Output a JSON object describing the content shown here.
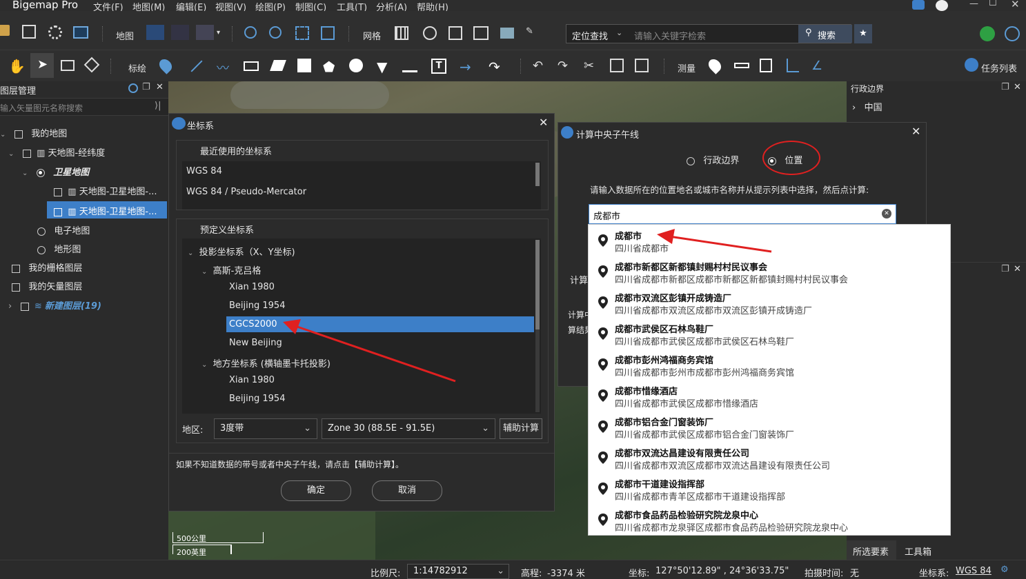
{
  "app": {
    "title": "Bigemap Pro"
  },
  "menu": [
    "文件(F)",
    "地图(M)",
    "编辑(E)",
    "视图(V)",
    "绘图(P)",
    "制图(C)",
    "工具(T)",
    "分析(A)",
    "帮助(H)"
  ],
  "toolbar1": {
    "map_label": "地图",
    "grid_label": "网格",
    "locate_label": "定位查找",
    "search_placeholder": "请输入关键字检索",
    "search_button": "搜索"
  },
  "toolbar2": {
    "draw_label": "标绘",
    "measure_label": "测量",
    "task_label": "任务列表"
  },
  "layers": {
    "title": "图层管理",
    "search_placeholder": "输入矢量图元名称搜索",
    "items": [
      "我的地图",
      "天地图-经纬度",
      "卫星地图",
      "天地图-卫星地图-...",
      "天地图-卫星地图-...",
      "电子地图",
      "地形图",
      "我的栅格图层",
      "我的矢量图层",
      "新建图层(19)"
    ]
  },
  "right_panel": {
    "title": "行政边界",
    "item": "中国",
    "tab_selected": "所选要素",
    "tab_tools": "工具箱"
  },
  "coord_dialog": {
    "title": "坐标系",
    "recent_title": "最近使用的坐标系",
    "recent": [
      "WGS 84",
      "WGS 84 / Pseudo-Mercator"
    ],
    "predefined_title": "预定义坐标系",
    "tree": [
      "投影坐标系（X、Y坐标)",
      "高斯-克吕格",
      "Xian 1980",
      "Beijing 1954",
      "CGCS2000",
      "New Beijing",
      "地方坐标系 (横轴墨卡托投影)",
      "Xian 1980",
      "Beijing 1954"
    ],
    "region_label": "地区:",
    "band_value": "3度带",
    "zone_value": "Zone 30 (88.5E - 91.5E)",
    "assist_button": "辅助计算",
    "hint": "如果不知道数据的带号或者中央子午线，请点击【辅助计算】。",
    "ok_button": "确定",
    "cancel_button": "取消"
  },
  "meridian_dialog": {
    "title": "计算中央子午线",
    "radio_admin": "行政边界",
    "radio_position": "位置",
    "instruction": "请输入数据所在的位置地名或城市名称并从提示列表中选择，然后点计算:",
    "input_value": "成都市",
    "calc_label": "计算",
    "partial_1": "计算中",
    "partial_2": "算结果"
  },
  "suggestions": [
    {
      "title": "成都市",
      "sub": "四川省成都市"
    },
    {
      "title": "成都市新都区新都镇封赐村村民议事会",
      "sub": "四川省成都市新都区成都市新都区新都镇封赐村村民议事会"
    },
    {
      "title": "成都市双流区彭镇开成铸造厂",
      "sub": "四川省成都市双流区成都市双流区彭镇开成铸造厂"
    },
    {
      "title": "成都市武侯区石林鸟鞋厂",
      "sub": "四川省成都市武侯区成都市武侯区石林鸟鞋厂"
    },
    {
      "title": "成都市彭州鸿福商务宾馆",
      "sub": "四川省成都市彭州市成都市彭州鸿福商务宾馆"
    },
    {
      "title": "成都市惜缘酒店",
      "sub": "四川省成都市武侯区成都市惜缘酒店"
    },
    {
      "title": "成都市铝合金门窗装饰厂",
      "sub": "四川省成都市武侯区成都市铝合金门窗装饰厂"
    },
    {
      "title": "成都市双流达昌建设有限责任公司",
      "sub": "四川省成都市双流区成都市双流达昌建设有限责任公司"
    },
    {
      "title": "成都市干道建设指挥部",
      "sub": "四川省成都市青羊区成都市干道建设指挥部"
    },
    {
      "title": "成都市食品药品检验研究院龙泉中心",
      "sub": "四川省成都市龙泉驿区成都市食品药品检验研究院龙泉中心"
    }
  ],
  "scalebar": {
    "km": "500公里",
    "mi": "200英里"
  },
  "status": {
    "scale_label": "比例尺:",
    "scale_value": "1:14782912",
    "elev_label": "高程:",
    "elev_value": "-3374 米",
    "coord_label": "坐标:",
    "coord_value": "127°50'12.89\" , 24°36'33.75\"",
    "date_label": "拍摄时间:",
    "date_value": "无",
    "crs_label": "坐标系:",
    "crs_value": "WGS 84"
  },
  "colors": {
    "accent": "#3d7fc8",
    "annotation": "#e02020",
    "selected_row": "#3d7fc8"
  }
}
